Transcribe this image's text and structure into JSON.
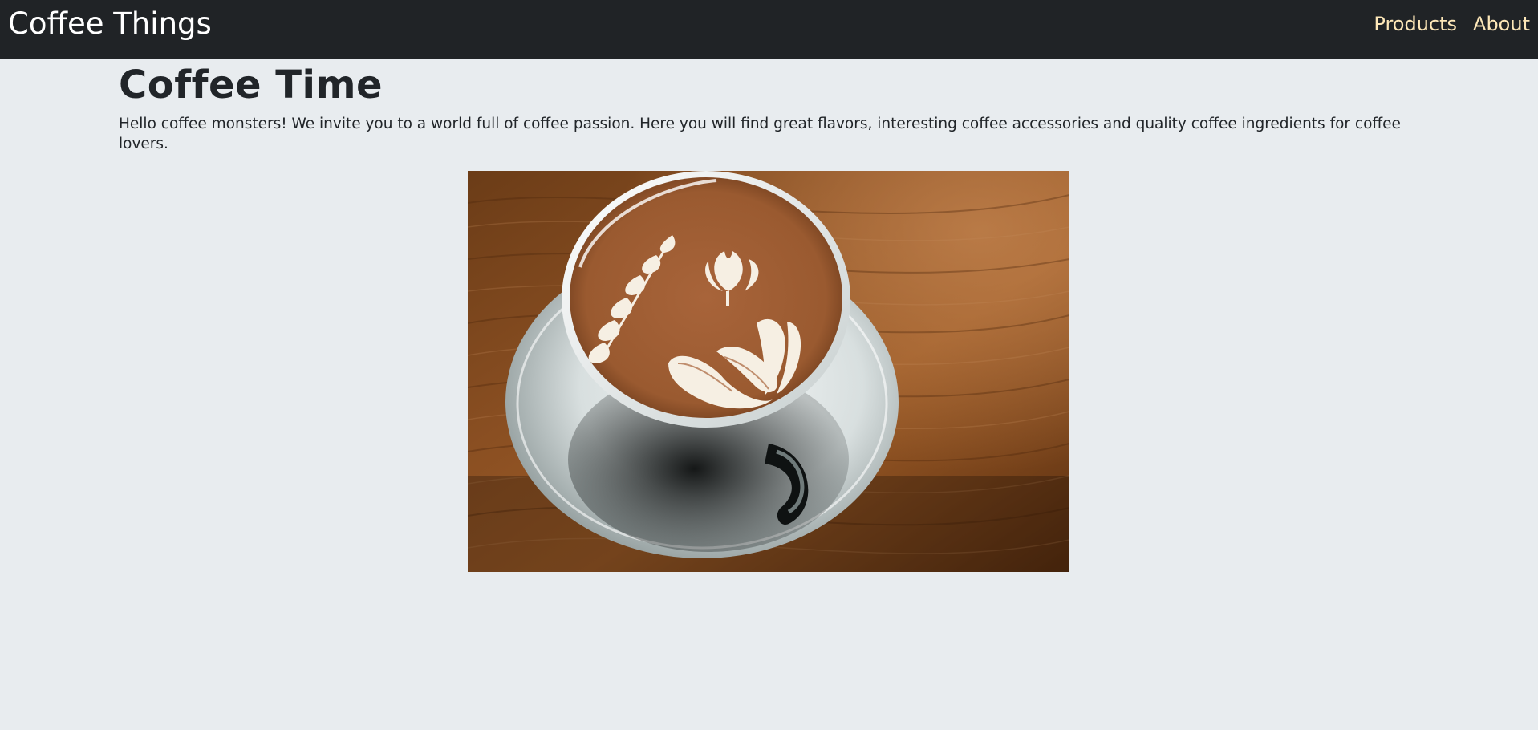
{
  "navbar": {
    "brand": "Coffee Things",
    "links": [
      {
        "label": "Products"
      },
      {
        "label": "About"
      }
    ]
  },
  "main": {
    "title": "Coffee Time",
    "intro": "Hello coffee monsters! We invite you to a world full of coffee passion. Here you will find great flavors, interesting coffee accessories and quality coffee ingredients for coffee lovers.",
    "hero_image": {
      "icon": "latte-art-cup-image"
    }
  },
  "colors": {
    "navbar_bg": "#202326",
    "page_bg": "#e8ecef",
    "nav_link": "#fde7b8",
    "brand": "#ffffff"
  }
}
